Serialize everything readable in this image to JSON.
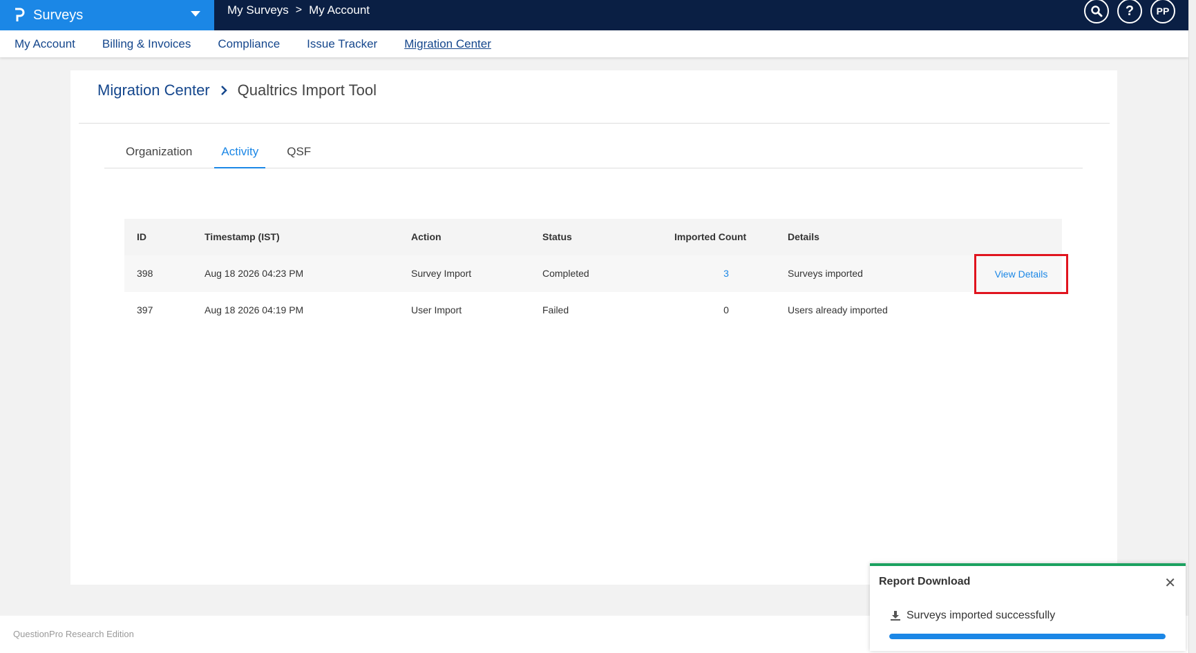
{
  "topbar": {
    "app_name": "Surveys",
    "breadcrumb": [
      "My Surveys",
      "My Account"
    ],
    "breadcrumb_separator": ">",
    "icons": [
      "search-icon",
      "help-icon"
    ],
    "avatar": "PP"
  },
  "subnav": {
    "items": [
      "My Account",
      "Billing & Invoices",
      "Compliance",
      "Issue Tracker",
      "Migration Center"
    ],
    "active": "Migration Center"
  },
  "page": {
    "breadcrumb_parent": "Migration Center",
    "breadcrumb_current": "Qualtrics Import Tool",
    "tabs": [
      "Organization",
      "Activity",
      "QSF"
    ],
    "active_tab": "Activity"
  },
  "table": {
    "headers": [
      "ID",
      "Timestamp (IST)",
      "Action",
      "Status",
      "Imported Count",
      "Details"
    ],
    "rows": [
      {
        "id": "398",
        "timestamp": "Aug 18 2026 04:23 PM",
        "action": "Survey Import",
        "status": "Completed",
        "count": "3",
        "details": "Surveys imported",
        "link": "View Details"
      },
      {
        "id": "397",
        "timestamp": "Aug 18 2026 04:19 PM",
        "action": "User Import",
        "status": "Failed",
        "count": "0",
        "details": "Users already imported",
        "link": ""
      }
    ]
  },
  "footer": {
    "text": "QuestionPro Research Edition"
  },
  "toast": {
    "title": "Report Download",
    "message": "Surveys imported successfully",
    "progress": 1.0,
    "accent": "#1ba160"
  },
  "colors": {
    "brand": "#1b87e6",
    "navy": "#0a1f44",
    "link": "#14468c",
    "highlight": "#e0141e"
  }
}
